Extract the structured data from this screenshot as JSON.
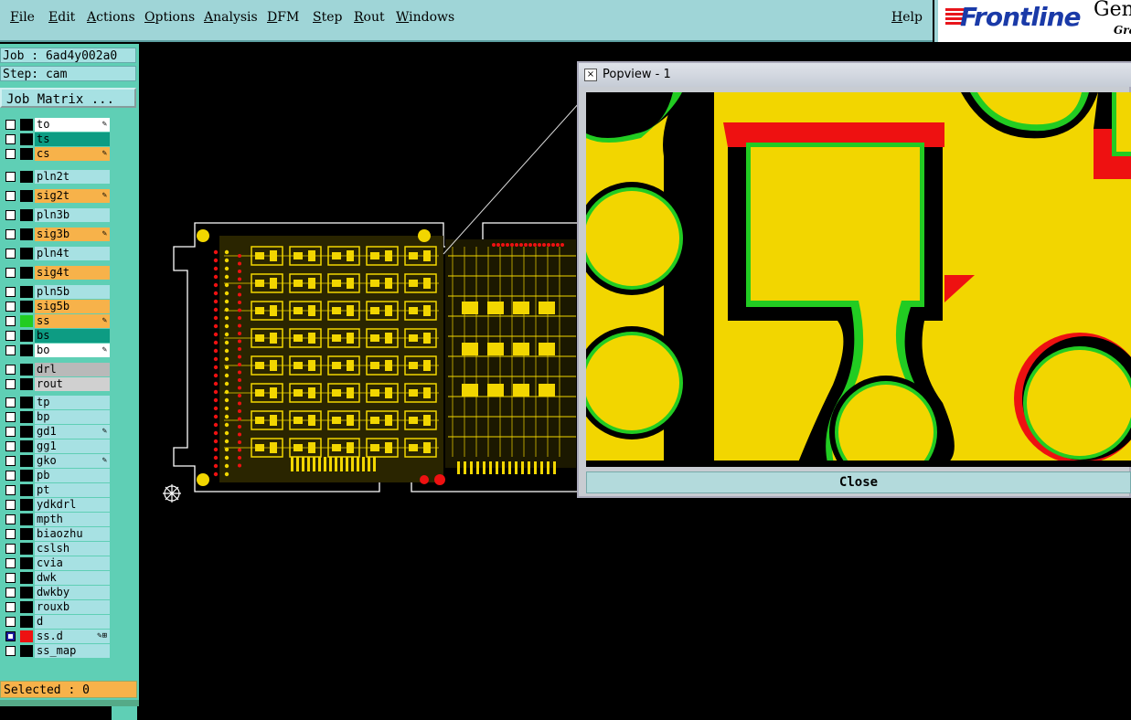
{
  "menubar": {
    "items": [
      "File",
      "Edit",
      "Actions",
      "Options",
      "Analysis",
      "DFM",
      "Step",
      "Rout",
      "Windows"
    ],
    "help": "Help"
  },
  "logo": {
    "text": "Frontline",
    "suffix": "Gen",
    "sub": "Gra"
  },
  "job": {
    "label": "Job : 6ad4y002a0",
    "step": "Step: cam",
    "matrix_button": "Job Matrix ..."
  },
  "layers": [
    {
      "name": "to",
      "color": "#ffffff",
      "swatch": "",
      "mark": "✎"
    },
    {
      "name": "ts",
      "color": "#0d9c83",
      "swatch": "",
      "mark": ""
    },
    {
      "name": "cs",
      "color": "#f7b24a",
      "swatch": "",
      "mark": "✎"
    },
    {
      "name": "pln2t",
      "color": "#a7e1e3",
      "swatch": "",
      "mark": ""
    },
    {
      "name": "sig2t",
      "color": "#f7b24a",
      "swatch": "",
      "mark": "✎"
    },
    {
      "name": "pln3b",
      "color": "#a7e1e3",
      "swatch": "",
      "mark": ""
    },
    {
      "name": "sig3b",
      "color": "#f7b24a",
      "swatch": "",
      "mark": "✎"
    },
    {
      "name": "pln4t",
      "color": "#a7e1e3",
      "swatch": "",
      "mark": ""
    },
    {
      "name": "sig4t",
      "color": "#f7b24a",
      "swatch": "",
      "mark": ""
    },
    {
      "name": "pln5b",
      "color": "#a7e1e3",
      "swatch": "",
      "mark": ""
    },
    {
      "name": "sig5b",
      "color": "#f7b24a",
      "swatch": "",
      "mark": ""
    },
    {
      "name": "ss",
      "color": "#f7b24a",
      "swatch": "#22cc22",
      "mark": "✎"
    },
    {
      "name": "bs",
      "color": "#0d9c83",
      "swatch": "",
      "mark": ""
    },
    {
      "name": "bo",
      "color": "#ffffff",
      "swatch": "",
      "mark": "✎"
    },
    {
      "name": "drl",
      "color": "#b9b9b9",
      "swatch": "",
      "mark": ""
    },
    {
      "name": "rout",
      "color": "#d0d0d0",
      "swatch": "",
      "mark": ""
    },
    {
      "name": "tp",
      "color": "#a7e1e3",
      "swatch": "",
      "mark": ""
    },
    {
      "name": "bp",
      "color": "#a7e1e3",
      "swatch": "",
      "mark": ""
    },
    {
      "name": "gd1",
      "color": "#a7e1e3",
      "swatch": "",
      "mark": "✎"
    },
    {
      "name": "gg1",
      "color": "#a7e1e3",
      "swatch": "",
      "mark": ""
    },
    {
      "name": "gko",
      "color": "#a7e1e3",
      "swatch": "",
      "mark": "✎"
    },
    {
      "name": "pb",
      "color": "#a7e1e3",
      "swatch": "",
      "mark": ""
    },
    {
      "name": "pt",
      "color": "#a7e1e3",
      "swatch": "",
      "mark": ""
    },
    {
      "name": "ydkdrl",
      "color": "#a7e1e3",
      "swatch": "",
      "mark": ""
    },
    {
      "name": "mpth",
      "color": "#a7e1e3",
      "swatch": "",
      "mark": ""
    },
    {
      "name": "biaozhu",
      "color": "#a7e1e3",
      "swatch": "",
      "mark": ""
    },
    {
      "name": "cslsh",
      "color": "#a7e1e3",
      "swatch": "",
      "mark": ""
    },
    {
      "name": "cvia",
      "color": "#a7e1e3",
      "swatch": "",
      "mark": ""
    },
    {
      "name": "dwk",
      "color": "#a7e1e3",
      "swatch": "",
      "mark": ""
    },
    {
      "name": "dwkby",
      "color": "#a7e1e3",
      "swatch": "",
      "mark": ""
    },
    {
      "name": "rouxb",
      "color": "#a7e1e3",
      "swatch": "",
      "mark": ""
    },
    {
      "name": "d",
      "color": "#a7e1e3",
      "swatch": "",
      "mark": ""
    },
    {
      "name": "ss.d",
      "color": "#a7e1e3",
      "swatch": "#ee1111",
      "mark": "✎⊞",
      "checked": true
    },
    {
      "name": "ss_map",
      "color": "#a7e1e3",
      "swatch": "",
      "mark": ""
    }
  ],
  "status": {
    "selected": "Selected : 0"
  },
  "popview": {
    "title": "Popview - 1",
    "close": "Close"
  },
  "colors": {
    "copper": "#f2d600",
    "mask_red": "#ee1111",
    "pad_green": "#22cc22",
    "panel": "#5fcfb5",
    "menubar": "#9fd5d7"
  }
}
